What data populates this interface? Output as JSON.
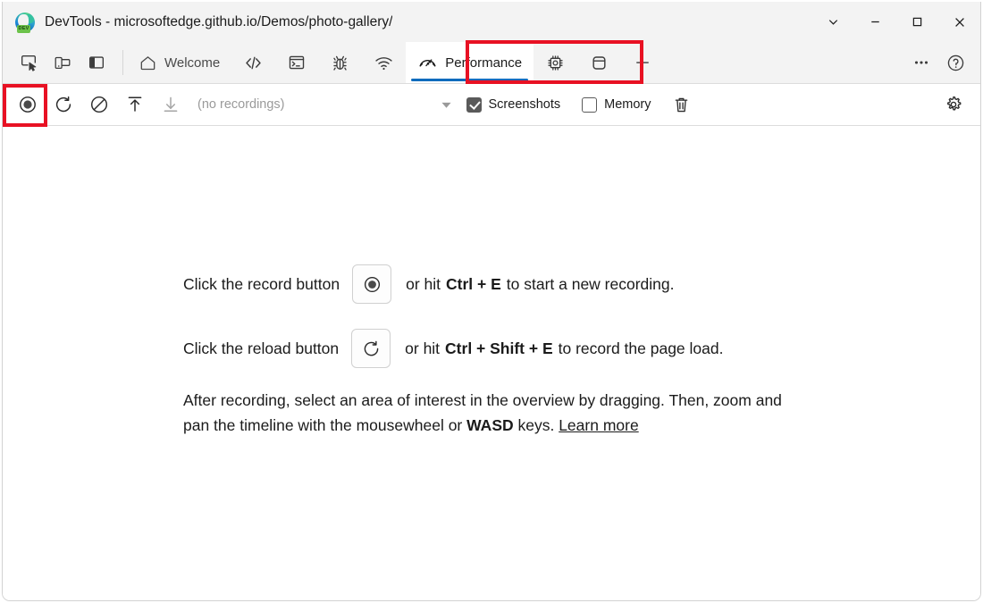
{
  "window": {
    "title": "DevTools - microsoftedge.github.io/Demos/photo-gallery/",
    "logo_badge": "DEV",
    "controls": {
      "more_label": "⌄",
      "minimize_label": "—",
      "maximize_label": "☐",
      "close_label": "✕"
    }
  },
  "toolbar_left": {
    "items": [
      {
        "name": "inspect-element-icon",
        "title": "Inspect"
      },
      {
        "name": "device-emulation-icon",
        "title": "Toggle device emulation"
      },
      {
        "name": "dock-side-icon",
        "title": "Dock side"
      }
    ]
  },
  "tabs": [
    {
      "id": "welcome",
      "label": "Welcome",
      "icon": "home-icon",
      "active": false,
      "has_label": true
    },
    {
      "id": "elements",
      "label": "Elements",
      "icon": "code-brackets-icon",
      "active": false,
      "has_label": false
    },
    {
      "id": "console",
      "label": "Console",
      "icon": "terminal-icon",
      "active": false,
      "has_label": false
    },
    {
      "id": "sources",
      "label": "Sources",
      "icon": "bug-icon",
      "active": false,
      "has_label": false
    },
    {
      "id": "network",
      "label": "Network",
      "icon": "wifi-icon",
      "active": false,
      "has_label": false
    },
    {
      "id": "performance",
      "label": "Performance",
      "icon": "speedometer-icon",
      "active": true,
      "has_label": true
    },
    {
      "id": "memory",
      "label": "Memory",
      "icon": "cpu-chip-icon",
      "active": false,
      "has_label": false
    },
    {
      "id": "application",
      "label": "Application",
      "icon": "database-icon",
      "active": false,
      "has_label": false
    },
    {
      "id": "more-tools",
      "label": "More tools",
      "icon": "plus-icon",
      "active": false,
      "has_label": false
    }
  ],
  "tabbar_right": {
    "more_options_label": "•••",
    "help_label": "?"
  },
  "record_toolbar": {
    "record_title": "Record",
    "reload_title": "Start profiling and reload page",
    "clear_title": "Clear",
    "load_title": "Load profile",
    "save_title": "Save profile",
    "recordings_text": "(no recordings)",
    "caret_label": "▼",
    "screenshots": {
      "label": "Screenshots",
      "checked": true
    },
    "memory": {
      "label": "Memory",
      "checked": false
    },
    "trash_title": "Delete recording",
    "settings_title": "Settings"
  },
  "main": {
    "row1": {
      "pre": "Click the record button",
      "icon": "record-circle-icon",
      "post_before": "or hit",
      "shortcut": "Ctrl + E",
      "post_after": "to start a new recording."
    },
    "row2": {
      "pre": "Click the reload button",
      "icon": "reload-arrow-icon",
      "post_before": "or hit",
      "shortcut": "Ctrl + Shift + E",
      "post_after": "to record the page load."
    },
    "paragraph": {
      "part1": "After recording, select an area of interest in the overview by dragging. Then, zoom and pan the timeline with the mousewheel or ",
      "bold": "WASD",
      "part2": " keys. ",
      "link": "Learn more"
    }
  },
  "annotations": {
    "highlight_color": "#E81123",
    "boxes": [
      {
        "name": "redbox-performance-tab",
        "target": "Performance tab"
      },
      {
        "name": "redbox-record-button",
        "target": "Record button"
      }
    ]
  },
  "colors": {
    "accent_blue": "#0F6CBD",
    "chrome_bg": "#F3F3F3",
    "panel_bg": "#FFFFFF",
    "text": "#1B1B1B",
    "muted_text": "#9A9A9A"
  }
}
